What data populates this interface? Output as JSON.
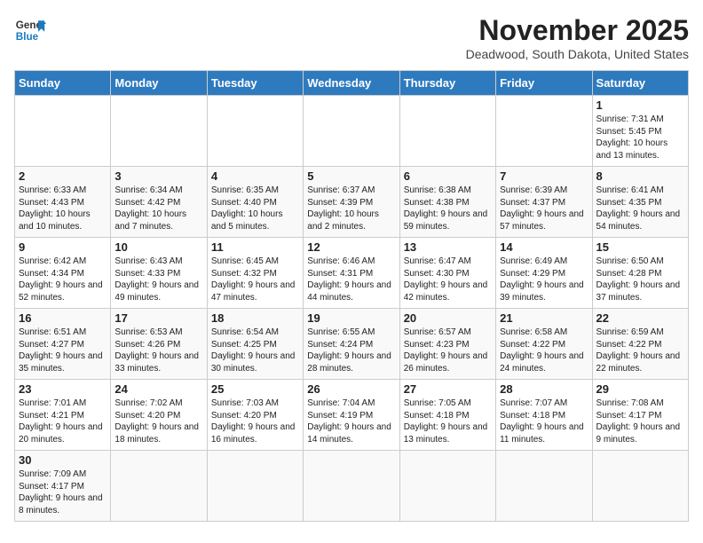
{
  "header": {
    "logo_general": "General",
    "logo_blue": "Blue",
    "month": "November 2025",
    "location": "Deadwood, South Dakota, United States"
  },
  "weekdays": [
    "Sunday",
    "Monday",
    "Tuesday",
    "Wednesday",
    "Thursday",
    "Friday",
    "Saturday"
  ],
  "weeks": [
    [
      {
        "day": "",
        "info": ""
      },
      {
        "day": "",
        "info": ""
      },
      {
        "day": "",
        "info": ""
      },
      {
        "day": "",
        "info": ""
      },
      {
        "day": "",
        "info": ""
      },
      {
        "day": "",
        "info": ""
      },
      {
        "day": "1",
        "info": "Sunrise: 7:31 AM\nSunset: 5:45 PM\nDaylight: 10 hours and 13 minutes."
      }
    ],
    [
      {
        "day": "2",
        "info": "Sunrise: 6:33 AM\nSunset: 4:43 PM\nDaylight: 10 hours and 10 minutes."
      },
      {
        "day": "3",
        "info": "Sunrise: 6:34 AM\nSunset: 4:42 PM\nDaylight: 10 hours and 7 minutes."
      },
      {
        "day": "4",
        "info": "Sunrise: 6:35 AM\nSunset: 4:40 PM\nDaylight: 10 hours and 5 minutes."
      },
      {
        "day": "5",
        "info": "Sunrise: 6:37 AM\nSunset: 4:39 PM\nDaylight: 10 hours and 2 minutes."
      },
      {
        "day": "6",
        "info": "Sunrise: 6:38 AM\nSunset: 4:38 PM\nDaylight: 9 hours and 59 minutes."
      },
      {
        "day": "7",
        "info": "Sunrise: 6:39 AM\nSunset: 4:37 PM\nDaylight: 9 hours and 57 minutes."
      },
      {
        "day": "8",
        "info": "Sunrise: 6:41 AM\nSunset: 4:35 PM\nDaylight: 9 hours and 54 minutes."
      }
    ],
    [
      {
        "day": "9",
        "info": "Sunrise: 6:42 AM\nSunset: 4:34 PM\nDaylight: 9 hours and 52 minutes."
      },
      {
        "day": "10",
        "info": "Sunrise: 6:43 AM\nSunset: 4:33 PM\nDaylight: 9 hours and 49 minutes."
      },
      {
        "day": "11",
        "info": "Sunrise: 6:45 AM\nSunset: 4:32 PM\nDaylight: 9 hours and 47 minutes."
      },
      {
        "day": "12",
        "info": "Sunrise: 6:46 AM\nSunset: 4:31 PM\nDaylight: 9 hours and 44 minutes."
      },
      {
        "day": "13",
        "info": "Sunrise: 6:47 AM\nSunset: 4:30 PM\nDaylight: 9 hours and 42 minutes."
      },
      {
        "day": "14",
        "info": "Sunrise: 6:49 AM\nSunset: 4:29 PM\nDaylight: 9 hours and 39 minutes."
      },
      {
        "day": "15",
        "info": "Sunrise: 6:50 AM\nSunset: 4:28 PM\nDaylight: 9 hours and 37 minutes."
      }
    ],
    [
      {
        "day": "16",
        "info": "Sunrise: 6:51 AM\nSunset: 4:27 PM\nDaylight: 9 hours and 35 minutes."
      },
      {
        "day": "17",
        "info": "Sunrise: 6:53 AM\nSunset: 4:26 PM\nDaylight: 9 hours and 33 minutes."
      },
      {
        "day": "18",
        "info": "Sunrise: 6:54 AM\nSunset: 4:25 PM\nDaylight: 9 hours and 30 minutes."
      },
      {
        "day": "19",
        "info": "Sunrise: 6:55 AM\nSunset: 4:24 PM\nDaylight: 9 hours and 28 minutes."
      },
      {
        "day": "20",
        "info": "Sunrise: 6:57 AM\nSunset: 4:23 PM\nDaylight: 9 hours and 26 minutes."
      },
      {
        "day": "21",
        "info": "Sunrise: 6:58 AM\nSunset: 4:22 PM\nDaylight: 9 hours and 24 minutes."
      },
      {
        "day": "22",
        "info": "Sunrise: 6:59 AM\nSunset: 4:22 PM\nDaylight: 9 hours and 22 minutes."
      }
    ],
    [
      {
        "day": "23",
        "info": "Sunrise: 7:01 AM\nSunset: 4:21 PM\nDaylight: 9 hours and 20 minutes."
      },
      {
        "day": "24",
        "info": "Sunrise: 7:02 AM\nSunset: 4:20 PM\nDaylight: 9 hours and 18 minutes."
      },
      {
        "day": "25",
        "info": "Sunrise: 7:03 AM\nSunset: 4:20 PM\nDaylight: 9 hours and 16 minutes."
      },
      {
        "day": "26",
        "info": "Sunrise: 7:04 AM\nSunset: 4:19 PM\nDaylight: 9 hours and 14 minutes."
      },
      {
        "day": "27",
        "info": "Sunrise: 7:05 AM\nSunset: 4:18 PM\nDaylight: 9 hours and 13 minutes."
      },
      {
        "day": "28",
        "info": "Sunrise: 7:07 AM\nSunset: 4:18 PM\nDaylight: 9 hours and 11 minutes."
      },
      {
        "day": "29",
        "info": "Sunrise: 7:08 AM\nSunset: 4:17 PM\nDaylight: 9 hours and 9 minutes."
      }
    ],
    [
      {
        "day": "30",
        "info": "Sunrise: 7:09 AM\nSunset: 4:17 PM\nDaylight: 9 hours and 8 minutes."
      },
      {
        "day": "",
        "info": ""
      },
      {
        "day": "",
        "info": ""
      },
      {
        "day": "",
        "info": ""
      },
      {
        "day": "",
        "info": ""
      },
      {
        "day": "",
        "info": ""
      },
      {
        "day": "",
        "info": ""
      }
    ]
  ]
}
